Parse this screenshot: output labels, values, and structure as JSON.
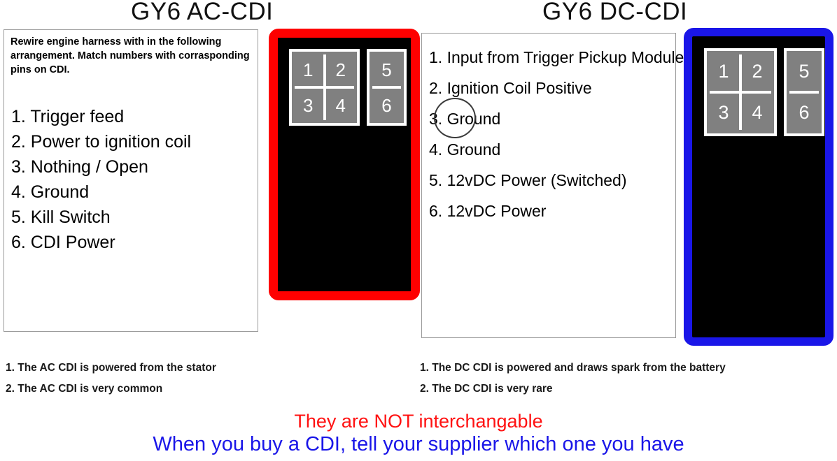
{
  "titles": {
    "ac": "GY6  AC-CDI",
    "dc": "GY6 DC-CDI"
  },
  "ac_panel": {
    "intro": "Rewire engine harness with in the following arrangement. Match numbers with corrasponding pins on CDI.",
    "pins": [
      "1. Trigger feed",
      "2. Power to ignition coil",
      "3. Nothing / Open",
      "4. Ground",
      "5. Kill Switch",
      "6. CDI Power"
    ]
  },
  "dc_panel": {
    "pins": [
      "1. Input from Trigger Pickup Module",
      "2. Ignition Coil Positive",
      "3. Ground",
      "4. Ground",
      "5. 12vDC Power (Switched)",
      "6. 12vDC Power"
    ],
    "annotation": "circle-highlight-on-pin-3"
  },
  "connectors": {
    "ac": {
      "border_color": "#fe0000",
      "body_color": "#000000",
      "pin_color": "#808080",
      "quad_pins": [
        "1",
        "2",
        "3",
        "4"
      ],
      "duo_pins": [
        "5",
        "6"
      ]
    },
    "dc": {
      "border_color": "#1a16e8",
      "body_color": "#000000",
      "pin_color": "#808080",
      "quad_pins": [
        "1",
        "2",
        "3",
        "4"
      ],
      "duo_pins": [
        "5",
        "6"
      ]
    }
  },
  "notes": {
    "ac": [
      "1. The AC CDI is powered from the stator",
      "2.  The AC CDI is very common"
    ],
    "dc": [
      "1. The DC CDI is powered and draws spark from the battery",
      "2.  The DC CDI is very rare"
    ]
  },
  "callouts": {
    "warning": "They are NOT interchangable",
    "advice": "When you buy a CDI, tell your supplier which one you have",
    "warning_color": "#ff1111",
    "advice_color": "#1a16e8"
  }
}
